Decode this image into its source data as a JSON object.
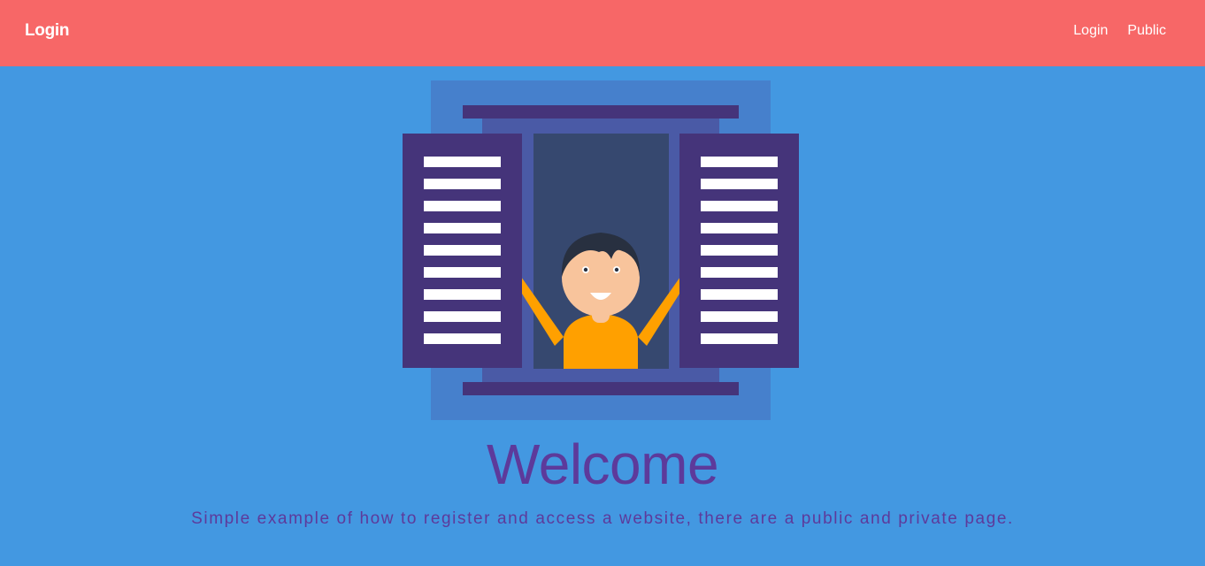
{
  "navbar": {
    "brand": "Login",
    "links": [
      {
        "label": "Login"
      },
      {
        "label": "Public"
      }
    ],
    "background_color": "#f76767"
  },
  "hero": {
    "illustration": "person-waving-from-window",
    "title": "Welcome",
    "subtitle": "Simple example of how to register and access a website, there are a public and private page."
  },
  "colors": {
    "page_background": "#4398e1",
    "text_purple": "#5d3a9b",
    "shutter_purple": "#45347a",
    "shirt_orange": "#ffa000"
  }
}
